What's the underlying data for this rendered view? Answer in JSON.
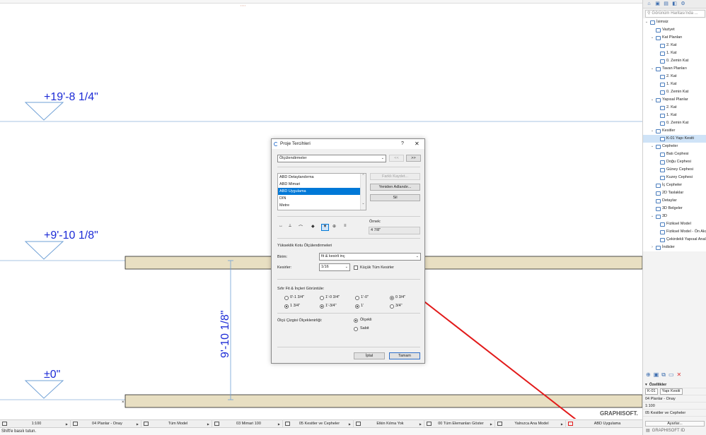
{
  "colors": {
    "dimension_text": "#1c2bd6",
    "slab": "#e8dfc2",
    "selection": "#0078d7",
    "arrow": "#e21a1a"
  },
  "canvas": {
    "elevation_labels": [
      "+19'-8 1/4\"",
      "+9'-10 1/8\"",
      "±0\""
    ],
    "vertical_dimension": "9'-10 1/8\"",
    "watermark": "GRAPHISOFT."
  },
  "dialog": {
    "title": "Proje Tercihleri",
    "help": "?",
    "close": "✕",
    "category": "Ölçülendirmeler",
    "nav_prev": "<<",
    "nav_next": ">>",
    "standards": [
      "ABD Detaylandırma",
      "ABD Mimari",
      "ABD Uygulama",
      "DIN",
      "Metre"
    ],
    "selected_standard": "ABD Uygulama",
    "buttons": {
      "save_as": "Farklı Kaydet...",
      "rename": "Yeniden Adlandır...",
      "delete": "Sil",
      "cancel": "İptal",
      "ok": "Tamam"
    },
    "tabs": [
      "↔",
      "⟂",
      "⌒",
      "◆",
      "▼",
      "⊕",
      "≡"
    ],
    "example_label": "Örnek:",
    "example_value": "4 7/8\"",
    "section_title": "Yükseklik Kotu Ölçülendirmeleri",
    "unit_label": "Birim:",
    "unit_value": "fit & kesirli inç",
    "fraction_label": "Kesirler:",
    "fraction_value": "1/16",
    "small_fraction_label": "Küçük Tüm Kesirler",
    "zero_section_title": "Sıfır Fit & İnçleri Görüntüle:",
    "zero_options": [
      "0'-1 3/4\"",
      "1'-0 3/4\"",
      "1'-0\"",
      "0 3/4\"",
      "1 3/4\"",
      "1'-3/4\"",
      "1'",
      "3/4\""
    ],
    "scaling_label": "Ölçü Çizgisi Ölçeklenirliği:",
    "scaling_options": [
      "Ölçekli",
      "Sabit"
    ]
  },
  "navigator": {
    "search_placeholder": "Görünüm Haritası'nda ...",
    "items": [
      "İsimsiz",
      "Vaziyet",
      "Kat Planları",
      "2. Kat",
      "1. Kat",
      "0. Zemin Kat",
      "Tavan Planları",
      "2. Kat",
      "1. Kat",
      "0. Zemin Kat",
      "Yapısal Planlar",
      "2. Kat",
      "1. Kat",
      "0. Zemin Kat",
      "Kesitler",
      "K-01 Yapı Kesiti",
      "Cepheler",
      "Batı Cephesi",
      "Doğu Cephesi",
      "Güney Cephesi",
      "Kuzey Cephesi",
      "İç Cepheler",
      "2D Taslaklar",
      "Detaylar",
      "3D Belgeler",
      "3D",
      "Fiziksel Model",
      "Fiziksel Model - Ön Aksonometri",
      "Çekirdekli Yapısal Analiz Modeli",
      "İndisler"
    ]
  },
  "properties": {
    "header": "Özellikler",
    "id": "K-01",
    "name": "Yapı Kesiti",
    "layer": "04 Planlar - Onay",
    "scale": "1:100",
    "section": "05 Kesitler ve Cepheler",
    "settings": "Ayarlar...",
    "footer": "GRAPHISOFT ID"
  },
  "statusbar": {
    "items": [
      "1:100",
      "04 Planlar - Onay",
      "Tüm Model",
      "03 Mimari 100",
      "05 Kesitler ve Cepheler",
      "Etkin Kılma Yok",
      "00 Tüm Elemanları Göster",
      "Yalnızca Ana Model",
      "ABD Uygulama"
    ],
    "hint": "Shift'e basılı tutun."
  }
}
